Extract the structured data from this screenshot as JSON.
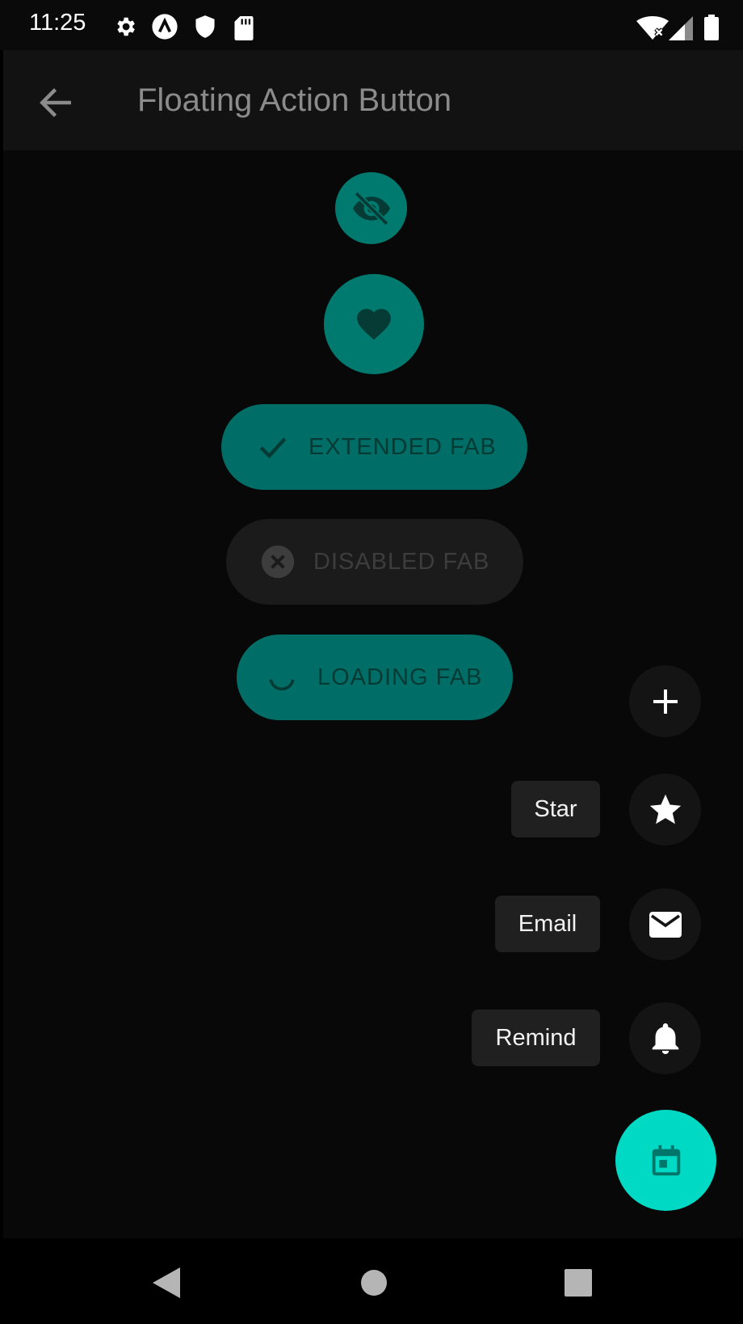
{
  "status_bar": {
    "time": "11:25",
    "left_icons": [
      "gear-icon",
      "a-circle-icon",
      "shield-icon",
      "sd-card-icon"
    ],
    "right_icons": [
      "wifi-off-icon",
      "cell-signal-icon",
      "battery-icon"
    ]
  },
  "app_bar": {
    "title": "Floating Action Button",
    "back_icon": "arrow-left-icon"
  },
  "fabs": {
    "small_icon": "eye-off-icon",
    "regular_icon": "heart-icon",
    "extended": {
      "label": "EXTENDED FAB",
      "icon": "check-icon"
    },
    "disabled": {
      "label": "DISABLED FAB",
      "icon": "cancel-icon"
    },
    "loading": {
      "label": "LOADING FAB",
      "icon": "spinner-icon"
    }
  },
  "speed_dial": {
    "items": [
      {
        "label": "",
        "icon": "plus-icon"
      },
      {
        "label": "Star",
        "icon": "star-icon"
      },
      {
        "label": "Email",
        "icon": "mail-icon"
      },
      {
        "label": "Remind",
        "icon": "bell-icon"
      }
    ],
    "main_icon": "calendar-icon"
  },
  "colors": {
    "fab_teal": "#007a6e",
    "main_fab_accent": "#00d9c4",
    "background": "#080808"
  },
  "nav_bar": {
    "buttons": [
      "back-triangle-icon",
      "home-circle-icon",
      "recents-square-icon"
    ]
  }
}
